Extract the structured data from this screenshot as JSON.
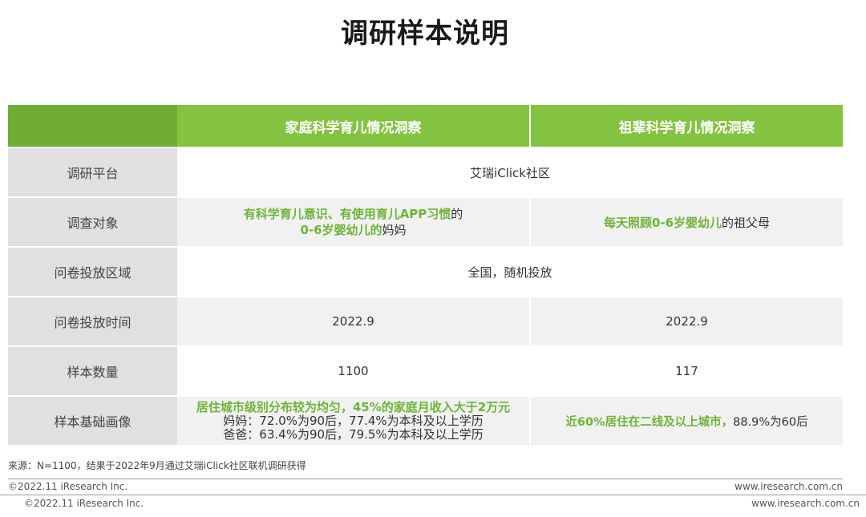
{
  "title": "调研样本说明",
  "table": {
    "headers": [
      "",
      "家庭科学育儿情况洞察",
      "祖辈科学育儿情况洞察"
    ],
    "rows": {
      "platform": {
        "label": "调研平台",
        "merged": "艾瑞iClick社区"
      },
      "target": {
        "label": "调查对象",
        "col1_line1_green": "有科学育儿意识、有使用育儿APP习惯",
        "col1_line1_plain": "的",
        "col1_line2_green": "0-6岁婴幼儿的",
        "col1_line2_plain": "妈妈",
        "col2_green": "每天照顾0-6岁婴幼儿",
        "col2_plain": "的祖父母"
      },
      "region": {
        "label": "问卷投放区域",
        "merged": "全国，随机投放"
      },
      "time": {
        "label": "问卷投放时间",
        "col1": "2022.9",
        "col2": "2022.9"
      },
      "count": {
        "label": "样本数量",
        "col1": "1100",
        "col2": "117"
      },
      "profile": {
        "label": "样本基础画像",
        "col1_line1_green": "居住城市级别分布较为均匀，45%的家庭月收入大于2万元",
        "col1_line2": "妈妈：72.0%为90后，77.4%为本科及以上学历",
        "col1_line3": "爸爸：63.4%为90后，79.5%为本科及以上学历",
        "col2_green": "近60%居住在二线及以上城市，",
        "col2_plain": "88.9%为60后"
      }
    }
  },
  "source": "来源：N=1100，结果于2022年9月通过艾瑞iClick社区联机调研获得",
  "footer": {
    "copyright": "©2022.11 iResearch Inc.",
    "website": "www.iresearch.com.cn"
  },
  "colors": {
    "accent": "#84c341",
    "accent_text": "#6fb33a",
    "label_bg": "#e0e0e0"
  }
}
